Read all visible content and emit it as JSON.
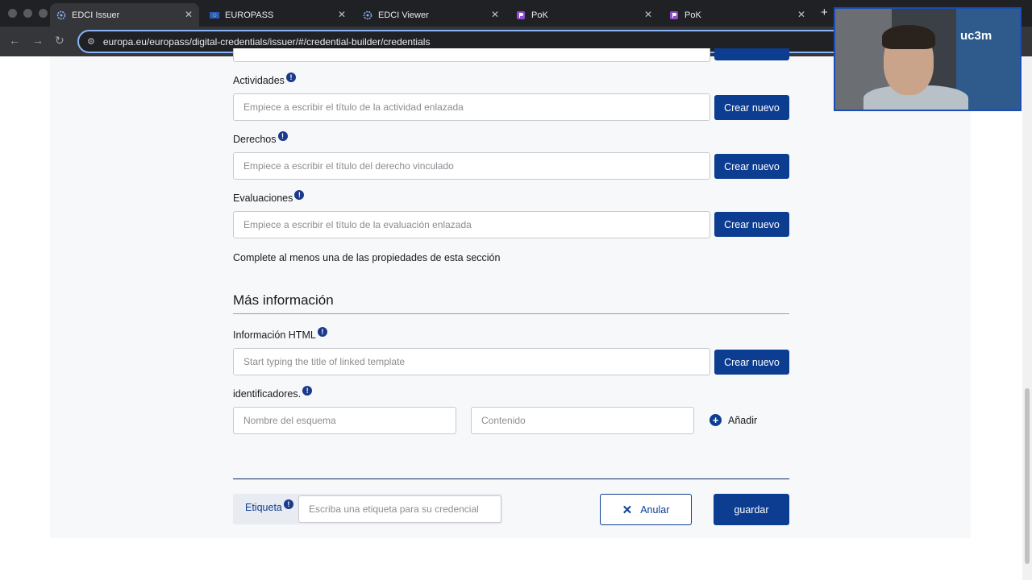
{
  "browser": {
    "tabs": [
      {
        "label": "EDCI Issuer",
        "icon": "gear-icon"
      },
      {
        "label": "EUROPASS",
        "icon": "eu-flag-icon"
      },
      {
        "label": "EDCI Viewer",
        "icon": "gear-icon"
      },
      {
        "label": "PoK",
        "icon": "pok-icon"
      },
      {
        "label": "PoK",
        "icon": "pok-icon"
      }
    ],
    "url": "europa.eu/europass/digital-credentials/issuer/#/credential-builder/credentials"
  },
  "form": {
    "activities": {
      "label": "Actividades",
      "placeholder": "Empiece a escribir el título de la actividad enlazada",
      "button": "Crear nuevo"
    },
    "rights": {
      "label": "Derechos",
      "placeholder": "Empiece a escribir el título del derecho vinculado",
      "button": "Crear nuevo"
    },
    "assessments": {
      "label": "Evaluaciones",
      "placeholder": "Empiece a escribir el título de la evaluación enlazada",
      "button": "Crear nuevo"
    },
    "note": "Complete al menos una de las propiedades de esta sección",
    "more_info": {
      "title": "Más información",
      "html_info": {
        "label": "Información HTML",
        "placeholder": "Start typing the title of linked template",
        "button": "Crear nuevo"
      },
      "identifiers": {
        "label": "identificadores.",
        "scheme_placeholder": "Nombre del esquema",
        "content_placeholder": "Contenido",
        "add_label": "Añadir"
      }
    }
  },
  "footer": {
    "tag_label": "Etiqueta",
    "tag_placeholder": "Escriba una etiqueta para su credencial",
    "cancel_label": "Anular",
    "save_label": "guardar"
  },
  "webcam": {
    "logo": "uc3m"
  },
  "colors": {
    "primary": "#0c3d91",
    "accent_focus": "#8ab4f8"
  }
}
